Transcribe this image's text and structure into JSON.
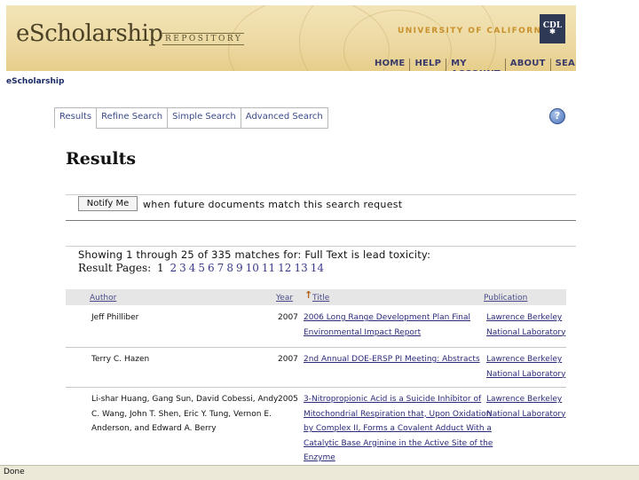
{
  "header": {
    "logo_main": "eScholarship",
    "logo_sub": "REPOSITORY",
    "university": "UNIVERSITY OF CALIFORNIA",
    "cdl": "CDL",
    "nav": [
      "HOME",
      "HELP",
      "MY ACCOUNT",
      "ABOUT",
      "SEARCH"
    ]
  },
  "breadcrumb": "eScholarship",
  "tabs": [
    "Results",
    "Refine Search",
    "Simple Search",
    "Advanced Search"
  ],
  "help_symbol": "?",
  "page_title": "Results",
  "notify": {
    "button": "Notify Me",
    "text": "when future documents match this search request"
  },
  "showing": "Showing 1 through 25 of 335 matches for: Full Text is lead toxicity:",
  "pagination": {
    "label": "Result Pages:",
    "current": "1",
    "pages": [
      "2",
      "3",
      "4",
      "5",
      "6",
      "7",
      "8",
      "9",
      "10",
      "11",
      "12",
      "13",
      "14"
    ]
  },
  "table": {
    "columns": [
      "Author",
      "Year",
      "Title",
      "Publication"
    ],
    "sort_symbol": "↑",
    "rows": [
      {
        "author": [
          "Jeff Philliber"
        ],
        "year": "2007",
        "title": [
          "2006 Long Range Development Plan Final",
          "Environmental Impact Report"
        ],
        "publication": [
          "Lawrence Berkeley",
          "National Laboratory"
        ]
      },
      {
        "author": [
          "Terry C. Hazen"
        ],
        "year": "2007",
        "title": [
          "2nd Annual DOE-ERSP PI Meeting: Abstracts"
        ],
        "publication": [
          "Lawrence Berkeley",
          "National Laboratory"
        ]
      },
      {
        "author": [
          "Li-shar Huang, Gang Sun, David Cobessi, Andy",
          "C. Wang, John T. Shen, Eric Y. Tung, Vernon E.",
          "Anderson, and Edward A. Berry"
        ],
        "year": "2005",
        "title": [
          "3-Nitropropionic Acid is a Suicide Inhibitor of",
          "Mitochondrial Respiration that, Upon Oxidation",
          "by Complex II, Forms a Covalent Adduct With a",
          "Catalytic Base Arginine in the Active Site of the",
          "Enzyme"
        ],
        "publication": [
          "Lawrence Berkeley",
          "National Laboratory"
        ]
      }
    ]
  },
  "status_bar": "Done"
}
